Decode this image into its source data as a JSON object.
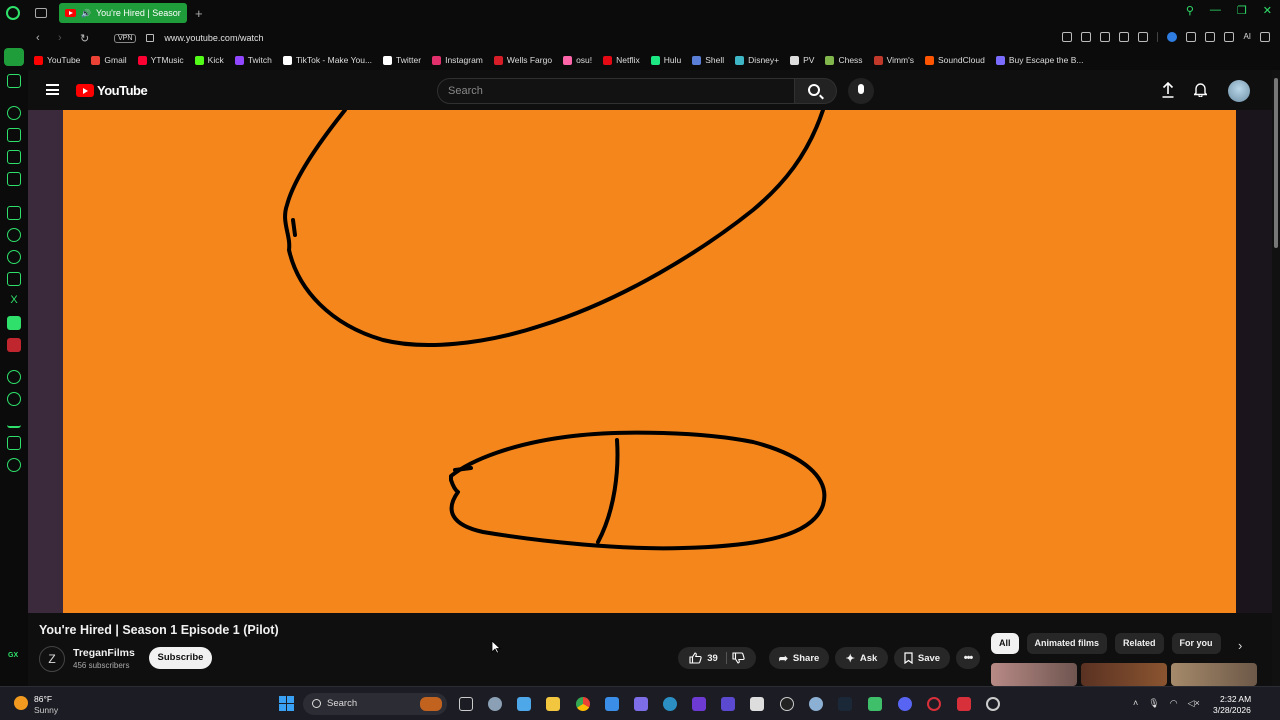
{
  "browser": {
    "tab_title": "You're Hired | Season",
    "url": "www.youtube.com/watch",
    "vpn_label": "VPN",
    "ai_label": "AI",
    "bookmarks": [
      {
        "label": "YouTube",
        "color": "#ff0000"
      },
      {
        "label": "Gmail",
        "color": "#ea4335"
      },
      {
        "label": "YTMusic",
        "color": "#ff0033"
      },
      {
        "label": "Kick",
        "color": "#53fc18"
      },
      {
        "label": "Twitch",
        "color": "#9146ff"
      },
      {
        "label": "TikTok - Make You...",
        "color": "#ffffff"
      },
      {
        "label": "Twitter",
        "color": "#ffffff"
      },
      {
        "label": "Instagram",
        "color": "#e1306c"
      },
      {
        "label": "Wells Fargo",
        "color": "#d71e28"
      },
      {
        "label": "osu!",
        "color": "#ff66aa"
      },
      {
        "label": "Netflix",
        "color": "#e50914"
      },
      {
        "label": "Hulu",
        "color": "#1ce783"
      },
      {
        "label": "Shell",
        "color": "#5b7fd6"
      },
      {
        "label": "Disney+",
        "color": "#3fb6c6"
      },
      {
        "label": "PV",
        "color": "#dddddd"
      },
      {
        "label": "Chess",
        "color": "#81b64c"
      },
      {
        "label": "Vimm's",
        "color": "#c0392b"
      },
      {
        "label": "SoundCloud",
        "color": "#ff5500"
      },
      {
        "label": "Buy Escape the B...",
        "color": "#7a6cff"
      }
    ]
  },
  "youtube": {
    "logo_text": "YouTube",
    "search_placeholder": "Search"
  },
  "video": {
    "title": "You're Hired | Season 1 Episode 1 (Pilot)",
    "background_color": "#f4861c",
    "channel": {
      "name": "TreganFilms",
      "subscribers": "456 subscribers",
      "avatar_text": "Z"
    },
    "subscribe_label": "Subscribe",
    "like_count": "39",
    "share_label": "Share",
    "ask_label": "Ask",
    "save_label": "Save"
  },
  "chips": [
    "All",
    "Animated films",
    "Related",
    "For you"
  ],
  "taskbar": {
    "temperature": "86°F",
    "condition": "Sunny",
    "search_label": "Search",
    "time": "2:32 AM",
    "date": "3/28/2026"
  },
  "colors": {
    "accent": "#1f9d3a",
    "gx_green": "#2fe06a",
    "yt_red": "#ff0000"
  }
}
